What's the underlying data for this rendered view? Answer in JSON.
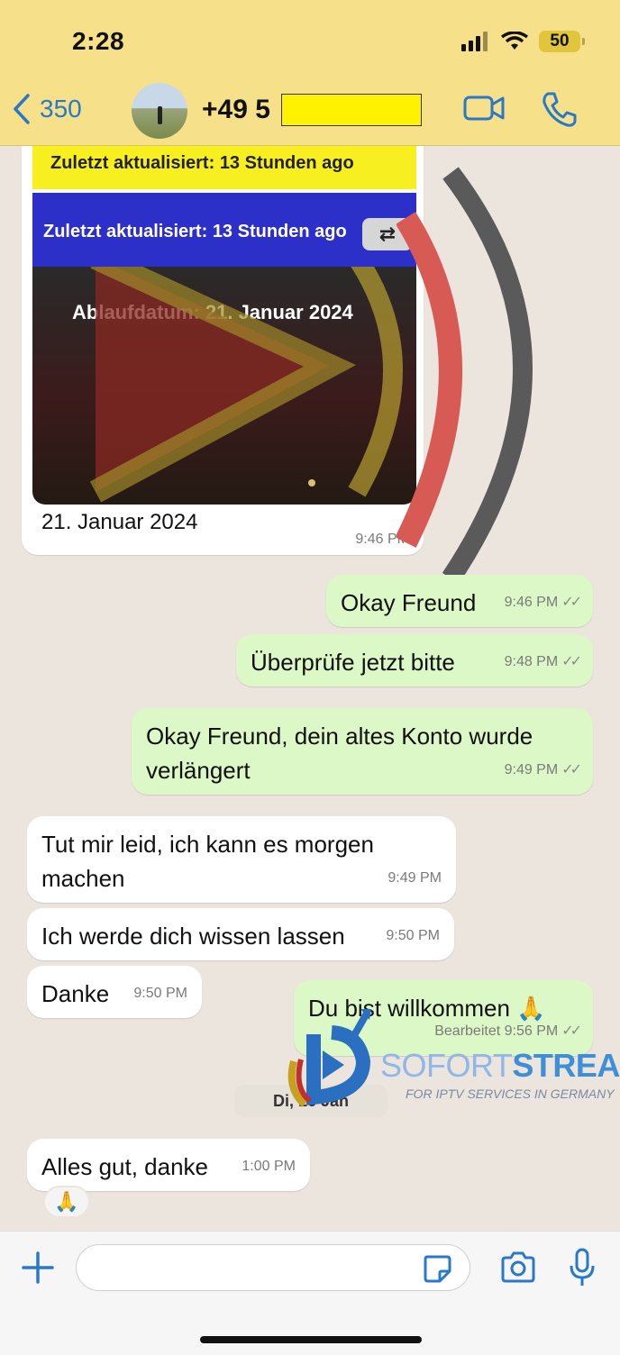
{
  "status_bar": {
    "time": "2:28",
    "battery": "50"
  },
  "header": {
    "back_count": "350",
    "contact_prefix": "+49 5"
  },
  "image_message": {
    "banner_yellow": "Zuletzt aktualisiert: 13 Stunden ago",
    "banner_blue": "Zuletzt aktualisiert: 13 Stunden ago",
    "expiry": "Ablaufdatum: 21. Januar 2024",
    "caption": "21. Januar 2024",
    "time": "9:46 PM"
  },
  "messages": [
    {
      "dir": "out",
      "text": "Okay Freund",
      "time": "9:46 PM"
    },
    {
      "dir": "out",
      "text": "Überprüfe jetzt bitte",
      "time": "9:48 PM"
    },
    {
      "dir": "out",
      "text": "Okay Freund, dein altes Konto wurde verlängert",
      "time": "9:49 PM"
    },
    {
      "dir": "in",
      "text": "Tut mir leid, ich kann es morgen machen",
      "time": "9:49 PM"
    },
    {
      "dir": "in",
      "text": "Ich werde dich wissen lassen",
      "time": "9:50 PM"
    },
    {
      "dir": "in",
      "text": "Danke",
      "time": "9:50 PM"
    },
    {
      "dir": "out",
      "text": "Du bist willkommen 🙏",
      "time": "Bearbeitet 9:56 PM"
    },
    {
      "dir": "in",
      "text": "Alles gut, danke",
      "time": "1:00 PM"
    }
  ],
  "date_chip": "Di, 16 Jan",
  "reaction": "🙏",
  "watermark": {
    "name_part1": "SOFORT",
    "name_part2": "STREAM",
    "tagline": "FOR IPTV SERVICES IN GERMANY"
  },
  "icons": {
    "back": "chevron-left-icon",
    "video": "video-call-icon",
    "phone": "phone-icon",
    "plus": "plus-icon",
    "sticker": "sticker-icon",
    "camera": "camera-icon",
    "mic": "microphone-icon"
  },
  "colors": {
    "header_bg": "#f6e08a",
    "outgoing": "#dcf8c6",
    "incoming": "#ffffff",
    "accent": "#2a78c8"
  }
}
